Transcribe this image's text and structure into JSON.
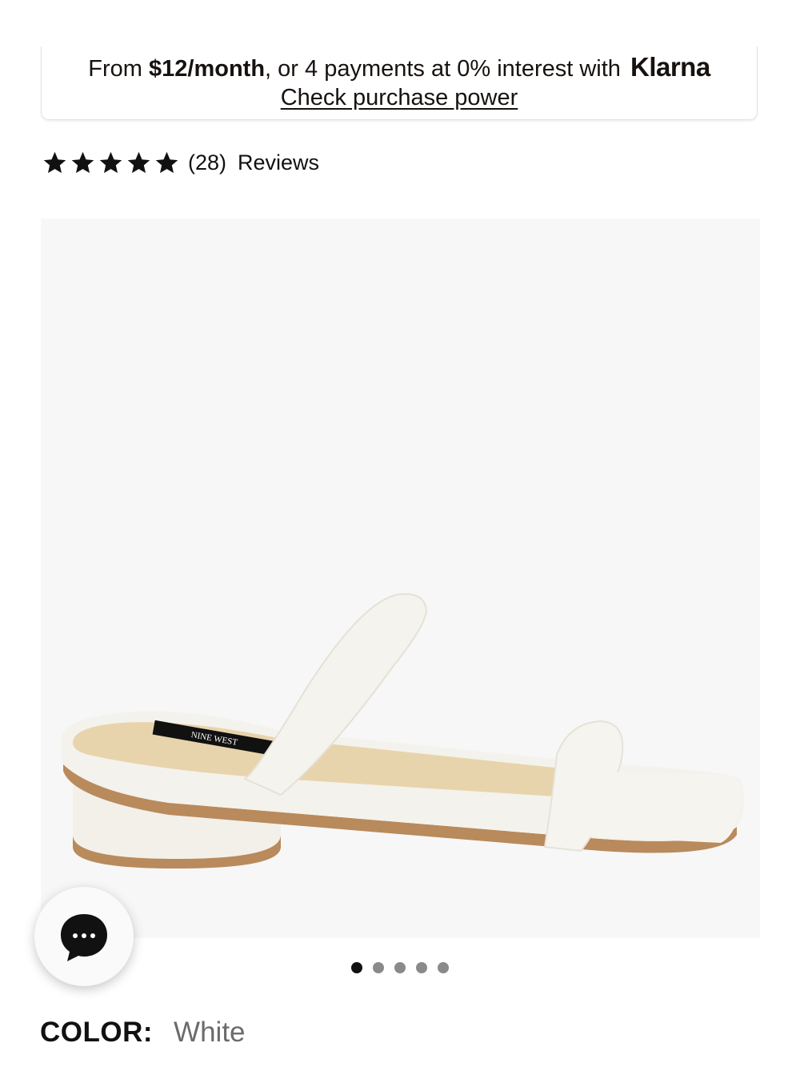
{
  "klarna": {
    "prefix": "From ",
    "amount": "$12/month",
    "middle": ", or 4 payments at 0% interest with ",
    "brand": "Klarna",
    "link": "Check purchase power"
  },
  "rating": {
    "stars": 5,
    "count": "(28)",
    "reviews_label": "Reviews"
  },
  "product": {
    "image_icon": "white-sandal-product-photo",
    "insole_label": "NINE WEST"
  },
  "chat": {
    "icon": "chat-bubble-icon"
  },
  "carousel": {
    "total": 5,
    "active_index": 0
  },
  "color": {
    "label": "COLOR:",
    "value": "White"
  }
}
